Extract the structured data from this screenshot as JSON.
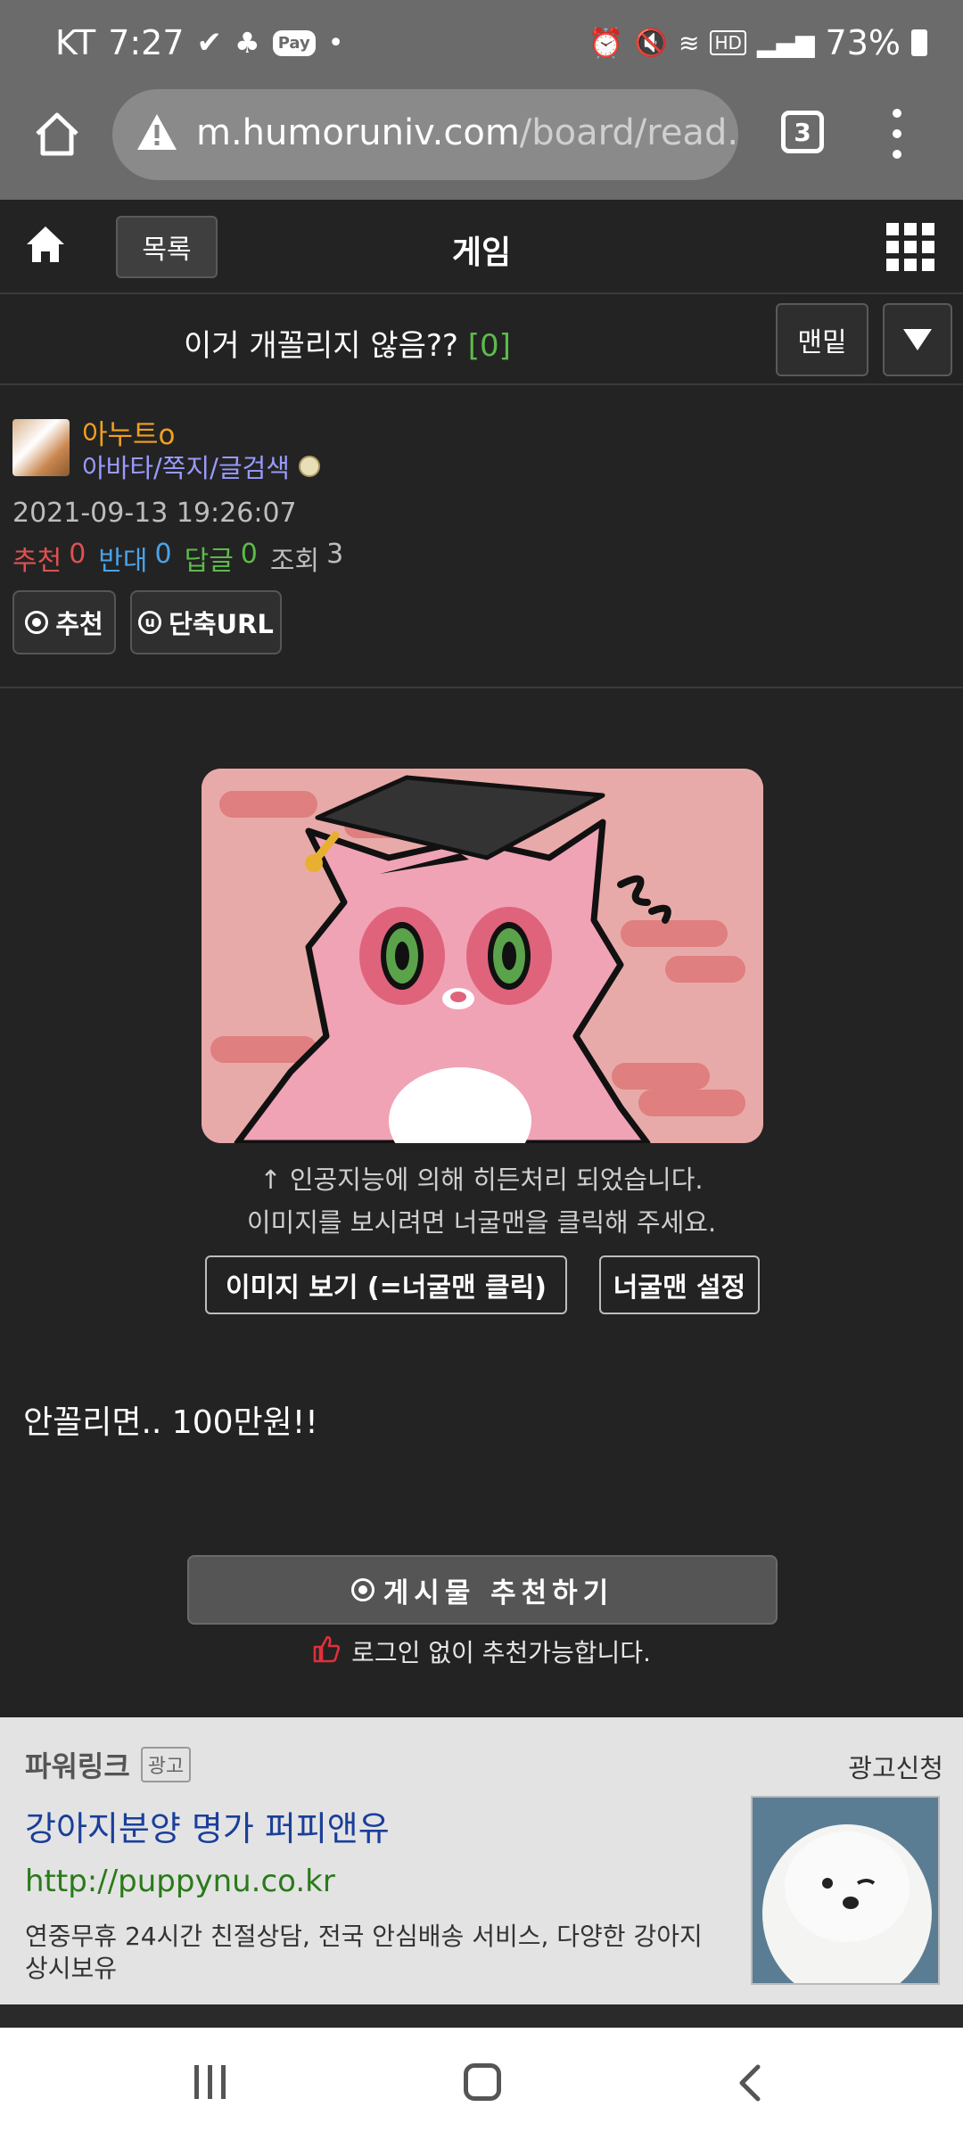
{
  "status_bar": {
    "carrier": "KT",
    "time": "7:27",
    "pay_label": "Pay",
    "battery": "73%"
  },
  "browser": {
    "url_host": "m.humoruniv.com",
    "url_path": "/board/read.h",
    "tab_count": "3"
  },
  "site_header": {
    "list_button": "목록",
    "board_name": "게임"
  },
  "post": {
    "title": "이거 개꼴리지 않음??",
    "comment_count": "[0]",
    "bottom_button": "맨밑",
    "author": "아누트o",
    "author_links": "아바타/쪽지/글검색",
    "date": "2021-09-13 19:26:07",
    "stats": {
      "recommend_label": "추천",
      "recommend_value": "0",
      "oppose_label": "반대",
      "oppose_value": "0",
      "reply_label": "답글",
      "reply_value": "0",
      "views_label": "조회",
      "views_value": "3"
    },
    "recommend_button": "추천",
    "short_url_button": "단축URL",
    "hidden_notice_1": "↑ 인공지능에 의해 히든처리 되었습니다.",
    "hidden_notice_2": "이미지를 보시려면 너굴맨을 클릭해 주세요.",
    "view_image_button": "이미지 보기 (=너굴맨 클릭)",
    "neogulman_settings_button": "너굴맨 설정",
    "body_text": "안꼴리면.. 100만원!!",
    "recommend_post_button": "게시물 추천하기",
    "login_free_notice": "로그인 없이 추천가능합니다."
  },
  "ad": {
    "powerlink_label": "파워링크",
    "ad_badge": "광고",
    "apply_link": "광고신청",
    "headline": "강아지분양 명가 퍼피앤유",
    "url": "http://puppynu.co.kr",
    "description": "연중무휴 24시간 친절상담, 전국 안심배송 서비스, 다양한 강아지 상시보유"
  },
  "colors": {
    "recommend": "#e05050",
    "oppose": "#4aa3e8",
    "reply": "#5dbb4a",
    "author": "#f0a020",
    "author_links": "#9a9aff",
    "comment_count": "#5dbb4a",
    "ad_headline": "#1a3e9a",
    "ad_url": "#2a7a1a"
  },
  "icons": [
    "home-icon",
    "warning-icon",
    "tab-count-icon",
    "more-vert-icon",
    "grid-menu-icon",
    "dropdown-triangle-icon",
    "recommend-circle-icon",
    "thumbs-up-icon",
    "recents-icon",
    "home-nav-icon",
    "back-icon"
  ]
}
